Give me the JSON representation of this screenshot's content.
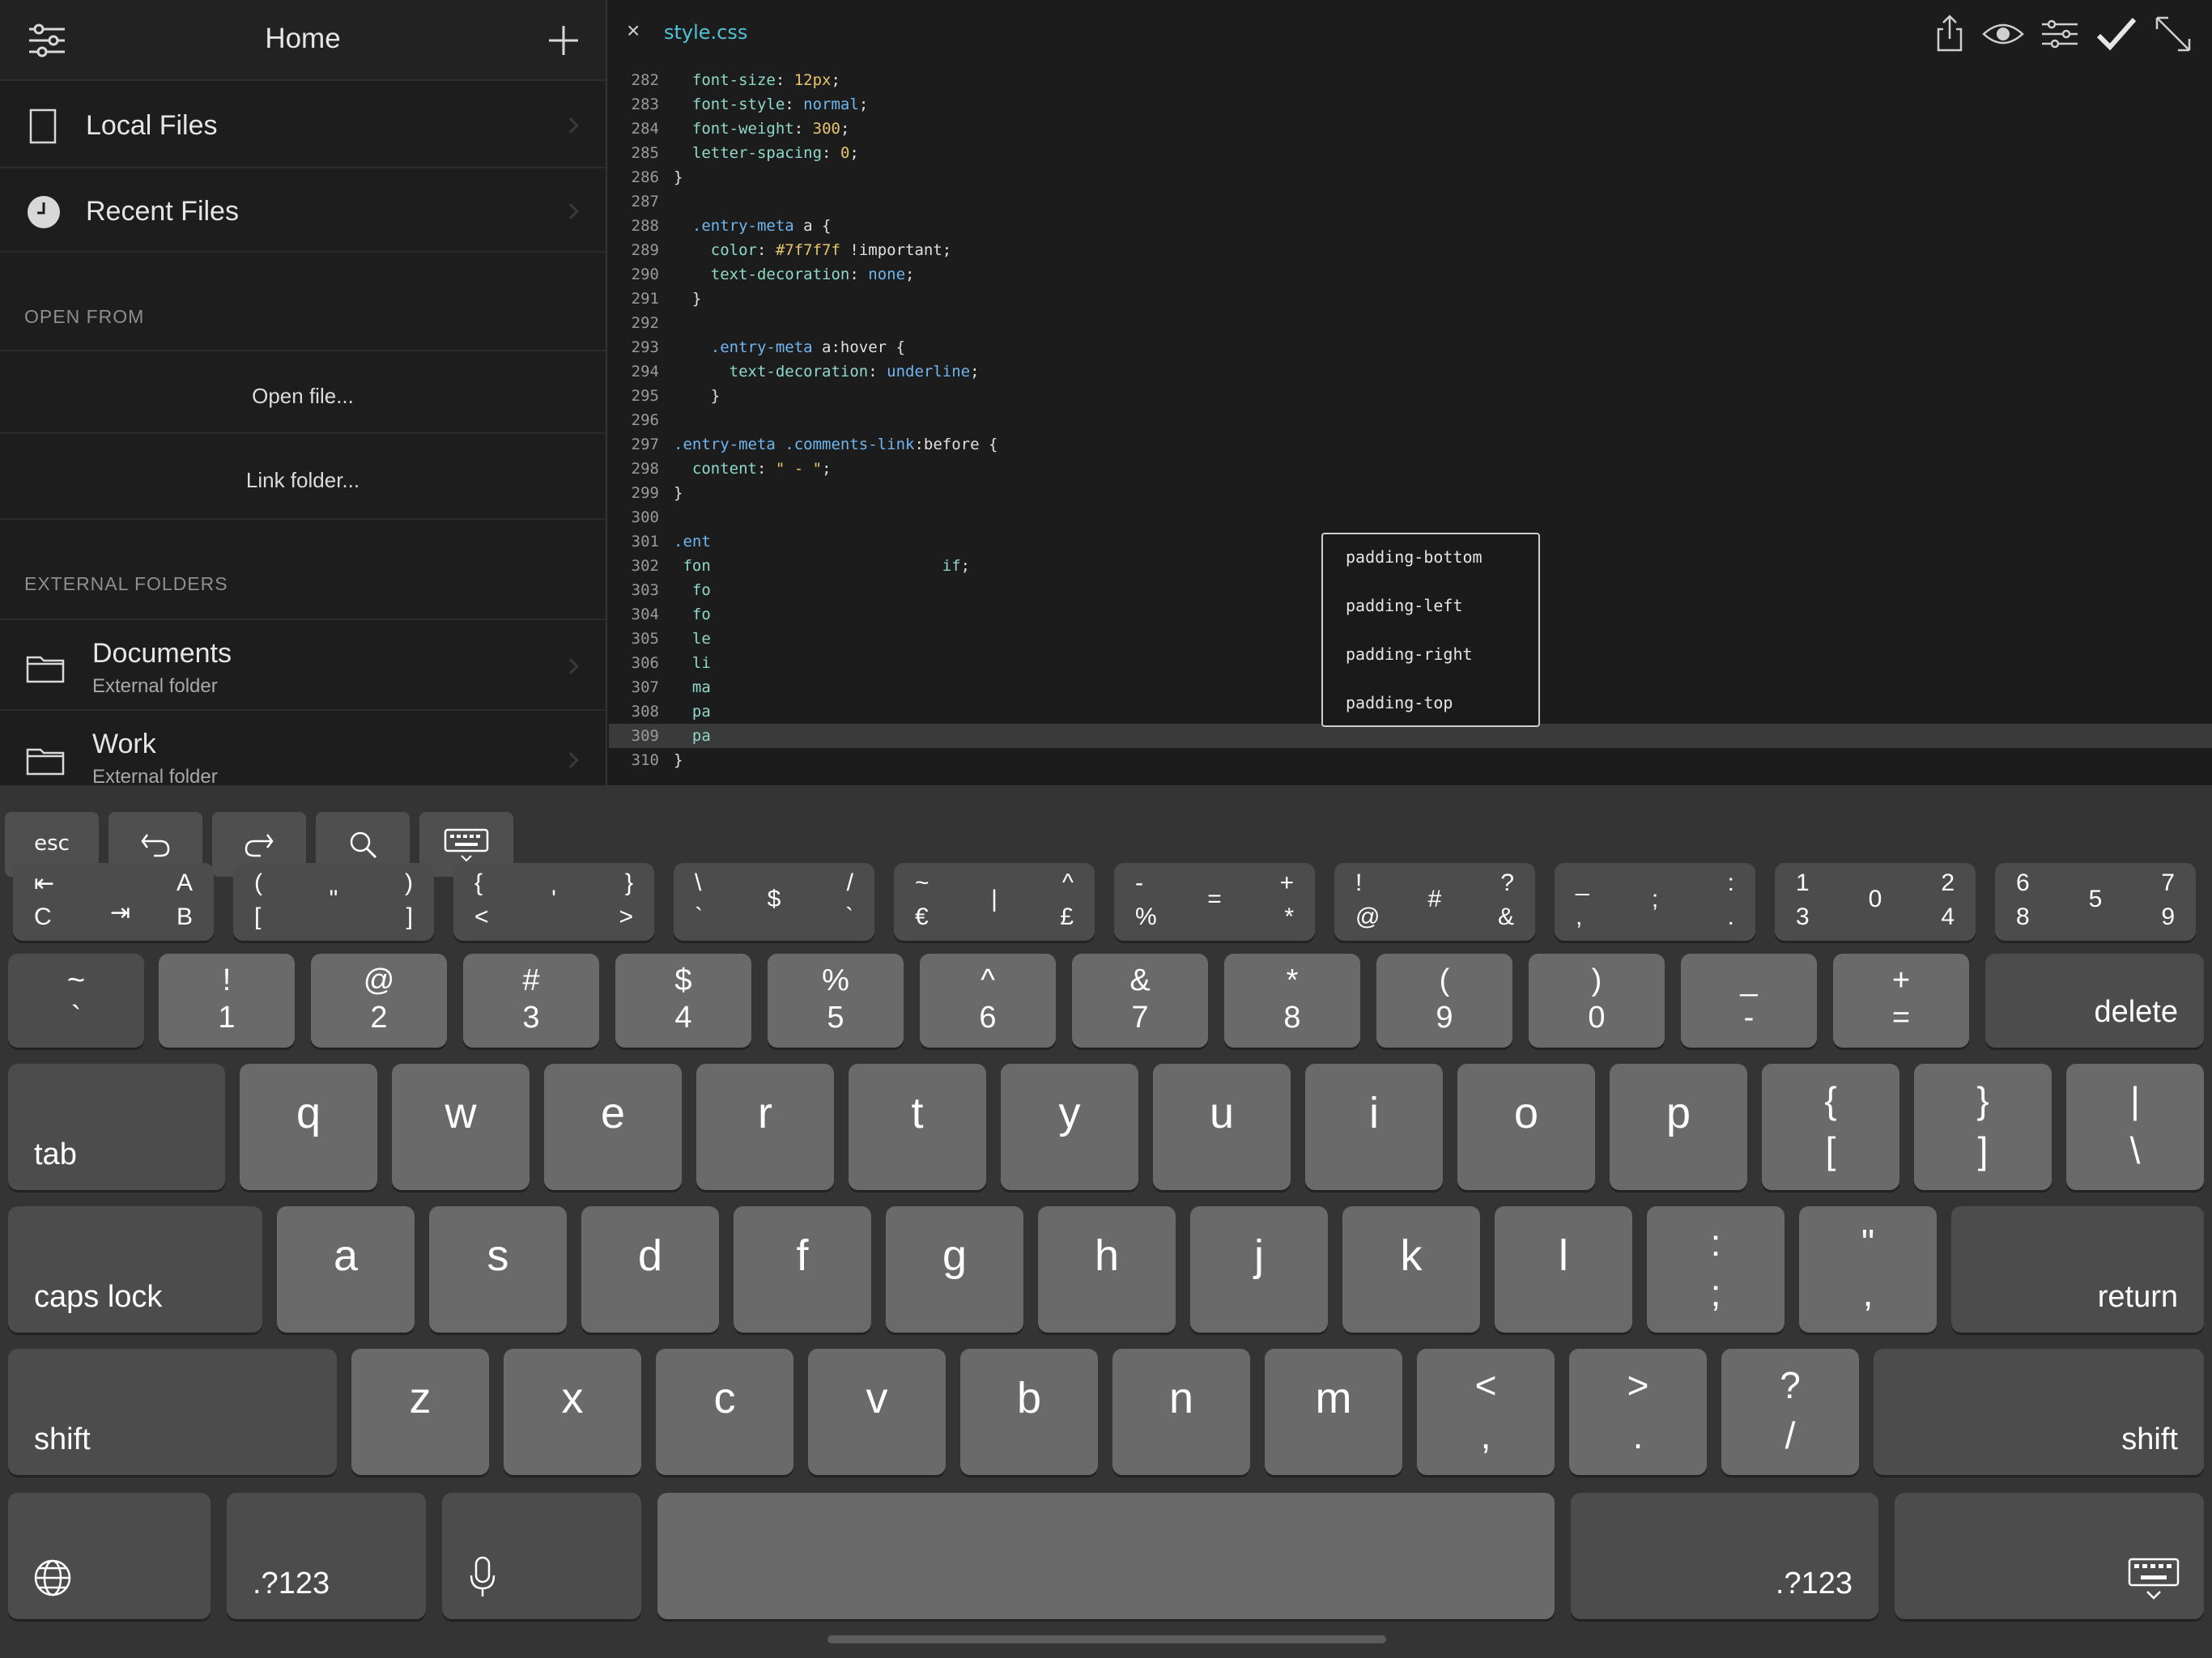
{
  "sidebar": {
    "title": "Home",
    "settings_icon": "sliders-icon",
    "add_icon": "plus-icon",
    "local_files": "Local Files",
    "recent_files": "Recent Files",
    "open_from_header": "OPEN FROM",
    "open_file": "Open file...",
    "link_folder": "Link folder...",
    "external_header": "EXTERNAL FOLDERS",
    "folders": [
      {
        "name": "Documents",
        "subtitle": "External folder"
      },
      {
        "name": "Work",
        "subtitle": "External folder"
      }
    ]
  },
  "editor": {
    "tab_close": "×",
    "filename": "style.css",
    "toolbar_icons": [
      "share-icon",
      "eye-icon",
      "sliders-icon",
      "checkmark-icon",
      "expand-icon"
    ],
    "lines": [
      {
        "n": "282",
        "html": "  <span class='p'>font-size</span>: <span class='n'>12px</span>;"
      },
      {
        "n": "283",
        "html": "  <span class='p'>font-style</span>: <span class='k'>normal</span>;"
      },
      {
        "n": "284",
        "html": "  <span class='p'>font-weight</span>: <span class='n'>300</span>;"
      },
      {
        "n": "285",
        "html": "  <span class='p'>letter-spacing</span>: <span class='n'>0</span>;"
      },
      {
        "n": "286",
        "html": "}"
      },
      {
        "n": "287",
        "html": ""
      },
      {
        "n": "288",
        "html": "  <span class='sel'>.entry-meta</span> a {"
      },
      {
        "n": "289",
        "html": "    <span class='p'>color</span>: <span class='n'>#7f7f7f</span> !important;"
      },
      {
        "n": "290",
        "html": "    <span class='p'>text-decoration</span>: <span class='k'>none</span>;"
      },
      {
        "n": "291",
        "html": "  }"
      },
      {
        "n": "292",
        "html": ""
      },
      {
        "n": "293",
        "html": "    <span class='sel'>.entry-meta</span> a:hover {"
      },
      {
        "n": "294",
        "html": "      <span class='p'>text-decoration</span>: <span class='k'>underline</span>;"
      },
      {
        "n": "295",
        "html": "    }"
      },
      {
        "n": "296",
        "html": ""
      },
      {
        "n": "297",
        "html": "<span class='sel'>.entry-meta</span> <span class='sel'>.comments-link</span>:before {"
      },
      {
        "n": "298",
        "html": "  <span class='p'>content</span>: <span class='s'>\" - \"</span>;"
      },
      {
        "n": "299",
        "html": "}"
      },
      {
        "n": "300",
        "html": ""
      },
      {
        "n": "301",
        "html": "<span class='sel'>.ent</span>"
      },
      {
        "n": "302",
        "html": " <span class='p'>fon</span>                         <span class='p'>if</span>;"
      },
      {
        "n": "303",
        "html": "  <span class='p'>fo</span>"
      },
      {
        "n": "304",
        "html": "  <span class='p'>fo</span>"
      },
      {
        "n": "305",
        "html": "  <span class='p'>le</span>"
      },
      {
        "n": "306",
        "html": "  <span class='p'>li</span>"
      },
      {
        "n": "307",
        "html": "  <span class='p'>ma</span>"
      },
      {
        "n": "308",
        "html": "  <span class='p'>pa</span>"
      },
      {
        "n": "309",
        "html": "  <span class='p'>pa</span>"
      },
      {
        "n": "310",
        "html": "}"
      }
    ],
    "active_line": "309",
    "autocomplete": [
      "padding-bottom",
      "padding-left",
      "padding-right",
      "padding-top"
    ]
  },
  "keyboard": {
    "toolbar": [
      "esc",
      "undo-icon",
      "redo-icon",
      "search-icon",
      "keyboard-icon"
    ],
    "symbol_row": [
      {
        "tl": "⇤",
        "tc": "",
        "tr": "A",
        "bl": "C",
        "bc": "⇥",
        "br": "B"
      },
      {
        "tl": "(",
        "tc": "\"",
        "tr": ")",
        "bl": "[",
        "bc": "",
        "br": "]"
      },
      {
        "tl": "{",
        "tc": "'",
        "tr": "}",
        "bl": "<",
        "bc": "",
        "br": ">"
      },
      {
        "tl": "\\",
        "tc": "$",
        "tr": "/",
        "bl": "`",
        "bc": "",
        "br": "`"
      },
      {
        "tl": "~",
        "tc": "|",
        "tr": "^",
        "bl": "€",
        "bc": "",
        "br": "£"
      },
      {
        "tl": "-",
        "tc": "=",
        "tr": "+",
        "bl": "%",
        "bc": "",
        "br": "*"
      },
      {
        "tl": "!",
        "tc": "#",
        "tr": "?",
        "bl": "@",
        "bc": "",
        "br": "&"
      },
      {
        "tl": "_",
        "tc": ";",
        "tr": ":",
        "bl": ",",
        "bc": "",
        "br": "."
      },
      {
        "tl": "1",
        "tc": "0",
        "tr": "2",
        "bl": "3",
        "bc": "",
        "br": "4"
      },
      {
        "tl": "6",
        "tc": "5",
        "tr": "7",
        "bl": "8",
        "bc": "",
        "br": "9"
      }
    ],
    "number_row": [
      {
        "t": "~",
        "b": "`"
      },
      {
        "t": "!",
        "b": "1"
      },
      {
        "t": "@",
        "b": "2"
      },
      {
        "t": "#",
        "b": "3"
      },
      {
        "t": "$",
        "b": "4"
      },
      {
        "t": "%",
        "b": "5"
      },
      {
        "t": "^",
        "b": "6"
      },
      {
        "t": "&",
        "b": "7"
      },
      {
        "t": "*",
        "b": "8"
      },
      {
        "t": "(",
        "b": "9"
      },
      {
        "t": ")",
        "b": "0"
      },
      {
        "t": "_",
        "b": "-"
      },
      {
        "t": "+",
        "b": "="
      }
    ],
    "delete": "delete",
    "tab": "tab",
    "row_q": [
      "q",
      "w",
      "e",
      "r",
      "t",
      "y",
      "u",
      "i",
      "o",
      "p"
    ],
    "row_q_extra": [
      {
        "t": "{",
        "b": "["
      },
      {
        "t": "}",
        "b": "]"
      },
      {
        "t": "|",
        "b": "\\"
      }
    ],
    "caps": "caps lock",
    "row_a": [
      "a",
      "s",
      "d",
      "f",
      "g",
      "h",
      "j",
      "k",
      "l"
    ],
    "row_a_extra": [
      {
        "t": ":",
        "b": ";"
      },
      {
        "t": "\"",
        "b": ","
      }
    ],
    "return": "return",
    "shift": "shift",
    "row_z": [
      "z",
      "x",
      "c",
      "v",
      "b",
      "n",
      "m"
    ],
    "row_z_extra": [
      {
        "t": "<",
        "b": ","
      },
      {
        "t": ">",
        "b": "."
      },
      {
        "t": "?",
        "b": "/"
      }
    ],
    "numbers_label": ".?123",
    "globe_icon": "globe-icon",
    "mic_icon": "microphone-icon",
    "dismiss_icon": "keyboard-dismiss-icon"
  }
}
